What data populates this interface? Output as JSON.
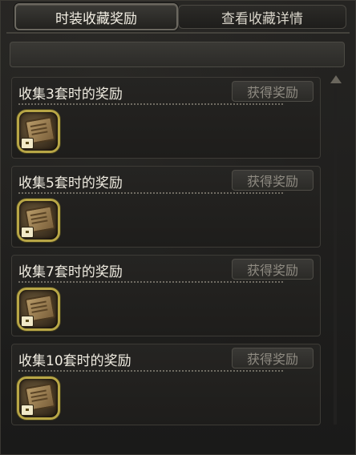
{
  "tabs": [
    {
      "label": "时装收藏奖励",
      "active": true
    },
    {
      "label": "查看收藏详情",
      "active": false
    }
  ],
  "rewards": [
    {
      "title": "收集3套时的奖励",
      "button": "获得奖励"
    },
    {
      "title": "收集5套时的奖励",
      "button": "获得奖励"
    },
    {
      "title": "收集7套时的奖励",
      "button": "获得奖励"
    },
    {
      "title": "收集10套时的奖励",
      "button": "获得奖励"
    }
  ],
  "icons": {
    "reward_item": "reward-scroll-icon",
    "badge": "chest-badge-icon",
    "scroll_up": "scroll-up-icon"
  },
  "colors": {
    "accent_border": "#b8a646",
    "disabled_text": "#8f8b82",
    "title_text": "#f1ede2"
  }
}
